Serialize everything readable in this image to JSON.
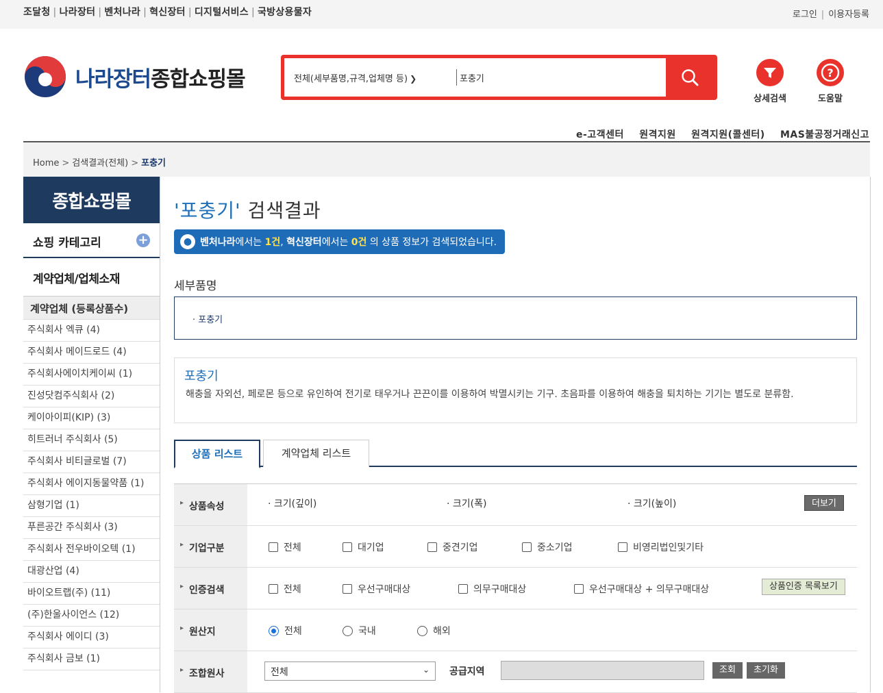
{
  "topbar": {
    "links": [
      "조달청",
      "나라장터",
      "벤처나라",
      "혁신장터",
      "디지털서비스",
      "국방상용물자"
    ],
    "login": "로그인",
    "register": "이용자등록"
  },
  "header": {
    "logo_brand": "나라장터",
    "logo_rest": "종합쇼핑몰",
    "search_scope": "전체(세부품명,규격,업체명 등)",
    "search_value": "포충기",
    "detail_search": "상세검색",
    "help": "도움말",
    "subnav": [
      "e-고객센터",
      "원격지원",
      "원격지원(콜센터)",
      "MAS불공정거래신고"
    ]
  },
  "breadcrumb": {
    "home": "Home",
    "level1": "검색결과(전체)",
    "current": "포충기"
  },
  "sidebar": {
    "title": "종합쇼핑몰",
    "category": "쇼핑 카테고리",
    "vendor_tab": "계약업체/업체소재",
    "list_header": "계약업체 (등록상품수)",
    "vendors": [
      "주식회사 엑큐 (4)",
      "주식회사 메이드로드 (4)",
      "주식회사에이치케이씨 (1)",
      "진성닷컴주식회사 (2)",
      "케이아이피(KIP) (3)",
      "히트러너 주식회사 (5)",
      "주식회사 비티글로벌 (7)",
      "주식회사 에이지동물약품 (1)",
      "삼형기업 (1)",
      "푸른공간 주식회사 (3)",
      "주식회사 전우바이오텍 (1)",
      "대광산업 (4)",
      "바이오트랩(주) (11)",
      "(주)한울사이언스 (12)",
      "주식회사 에이디 (3)",
      "주식회사 금보 (1)"
    ]
  },
  "main": {
    "title_q": "'포충기'",
    "title_rest": " 검색결과",
    "notice": {
      "v_name": "벤처나라",
      "v_mid": "에서는 ",
      "v_cnt": "1건",
      "sep": ", ",
      "i_name": "혁신장터",
      "i_mid": "에서는 ",
      "i_cnt": "0건",
      "tail": " 의 상품 정보가 검색되었습니다."
    },
    "detail_label": "세부품명",
    "detail_item": "포충기",
    "desc_name": "포충기",
    "desc_text": "해충을 자외선, 페로몬 등으로 유인하여 전기로 태우거나 끈끈이를 이용하여 박멸시키는 기구. 초음파를 이용하여 해충을 퇴치하는 기기는 별도로 분류함.",
    "tabs": [
      "상품 리스트",
      "계약업체 리스트"
    ],
    "filters": {
      "attr_label": "상품속성",
      "attrs": [
        "크기(깊이)",
        "크기(폭)",
        "크기(높이)"
      ],
      "more": "더보기",
      "company_label": "기업구분",
      "company_opts": [
        "전체",
        "대기업",
        "중견기업",
        "중소기업",
        "비영리법인및기타"
      ],
      "cert_label": "인증검색",
      "cert_opts": [
        "전체",
        "우선구매대상",
        "의무구매대상",
        "우선구매대상 + 의무구매대상"
      ],
      "cert_btn": "상품인증 목록보기",
      "origin_label": "원산지",
      "origin_opts": [
        "전체",
        "국내",
        "해외"
      ],
      "origin_selected": "전체",
      "union_label": "조합원사",
      "union_value": "전체",
      "supply_label": "공급지역",
      "search_btn": "조회",
      "reset_btn": "초기화"
    }
  },
  "colors": {
    "accent_red": "#e8322b",
    "navy": "#1e3a5f",
    "blue": "#1d6fb8"
  }
}
